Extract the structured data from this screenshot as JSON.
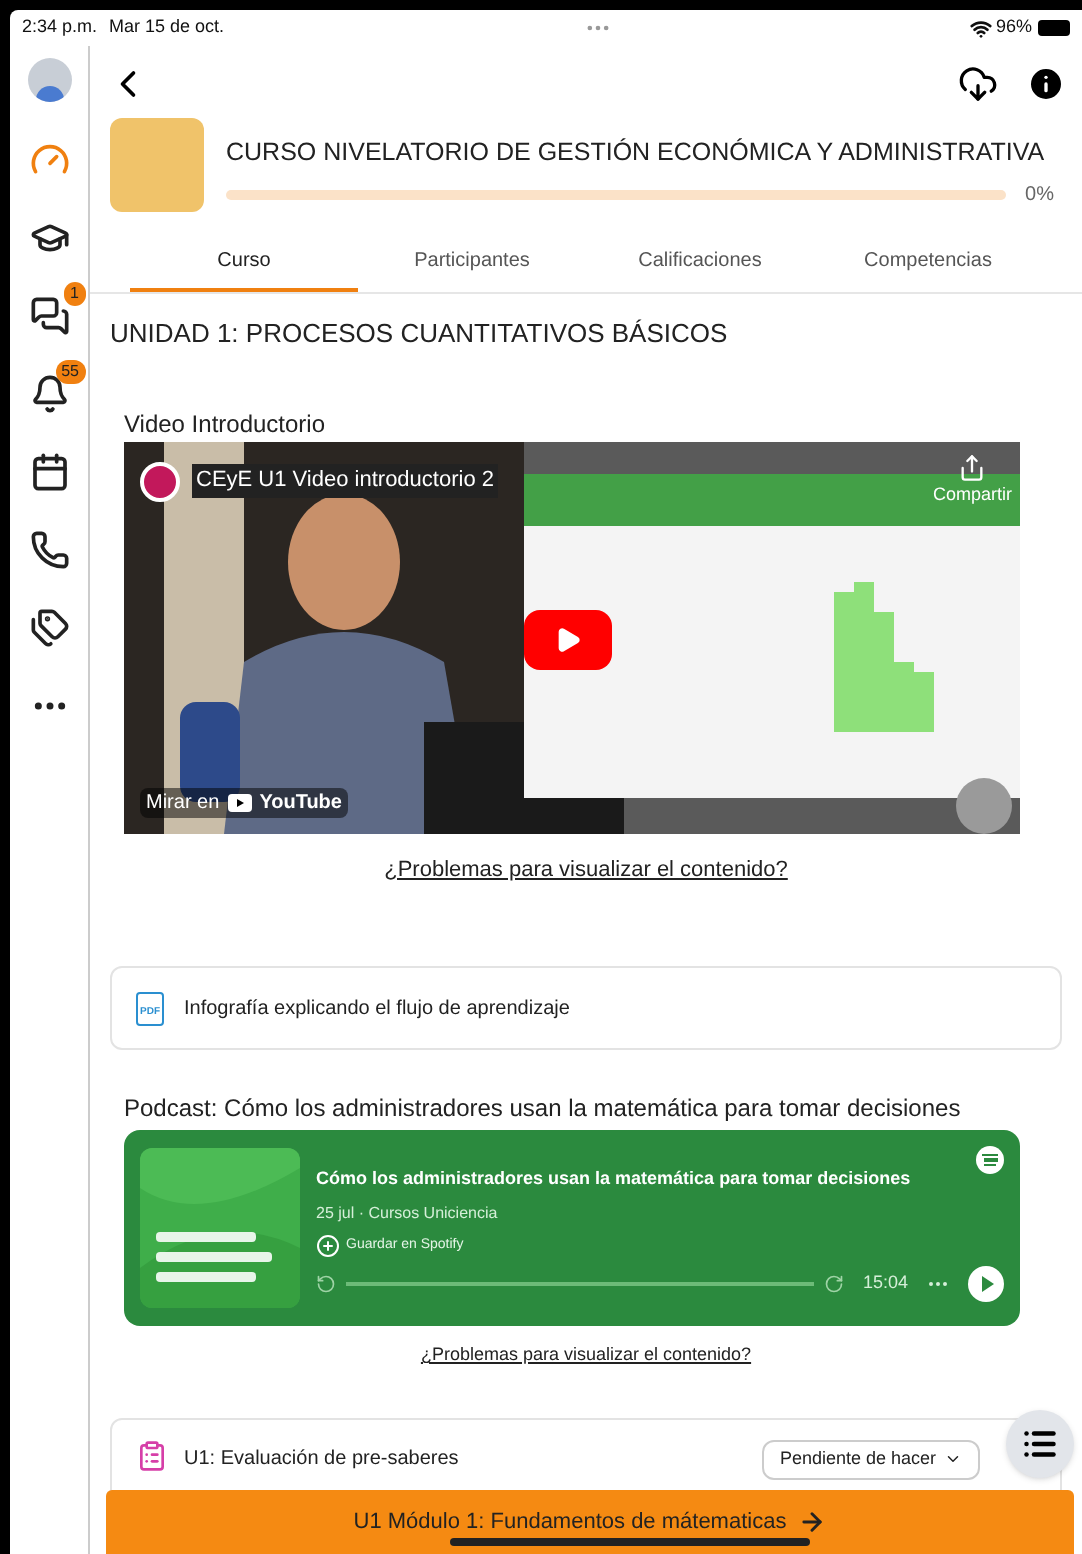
{
  "status_bar": {
    "time": "2:34 p.m.",
    "date": "Mar 15 de oct.",
    "battery": "96%"
  },
  "sidebar": {
    "items": [
      {
        "kind": "avatar"
      },
      {
        "kind": "dashboard",
        "selected": true
      },
      {
        "kind": "courses",
        "selected": false
      },
      {
        "kind": "messages",
        "selected": false,
        "badge": "1"
      },
      {
        "kind": "notifications",
        "selected": false,
        "badge": "55"
      },
      {
        "kind": "calendar",
        "selected": false
      },
      {
        "kind": "contacts",
        "selected": false
      },
      {
        "kind": "tags",
        "selected": false
      },
      {
        "kind": "more",
        "selected": false
      }
    ]
  },
  "course": {
    "title": "CURSO NIVELATORIO DE GESTIÓN ECONÓMICA Y ADMINISTRATIVA",
    "progress": "0%"
  },
  "tabs": [
    {
      "label": "Curso",
      "selected": true
    },
    {
      "label": "Participantes",
      "selected": false
    },
    {
      "label": "Calificaciones",
      "selected": false
    },
    {
      "label": "Competencias",
      "selected": false
    }
  ],
  "unit_title": "UNIDAD 1: PROCESOS CUANTITATIVOS BÁSICOS",
  "video": {
    "heading": "Video Introductorio",
    "title": "CEyE U1 Video introductorio 2",
    "share": "Compartir",
    "watch_on": "Mirar en",
    "platform": "YouTube",
    "help_link": "¿Problemas para visualizar el contenido?"
  },
  "pdf_card": {
    "label": "Infografía explicando el flujo de aprendizaje",
    "icon_text": "PDF"
  },
  "podcast": {
    "heading": "Podcast: Cómo los administradores usan la matemática para tomar decisiones",
    "episode": "Cómo los administradores usan la matemática para tomar decisiones",
    "meta": "25 jul · Cursos Uniciencia",
    "save": "Guardar en Spotify",
    "duration": "15:04",
    "help_link": "¿Problemas para visualizar el contenido?"
  },
  "activity": {
    "label": "U1: Evaluación de pre-saberes",
    "status": "Pendiente de hacer"
  },
  "next_button": {
    "label": "U1 Módulo 1: Fundamentos de mátematicas"
  }
}
